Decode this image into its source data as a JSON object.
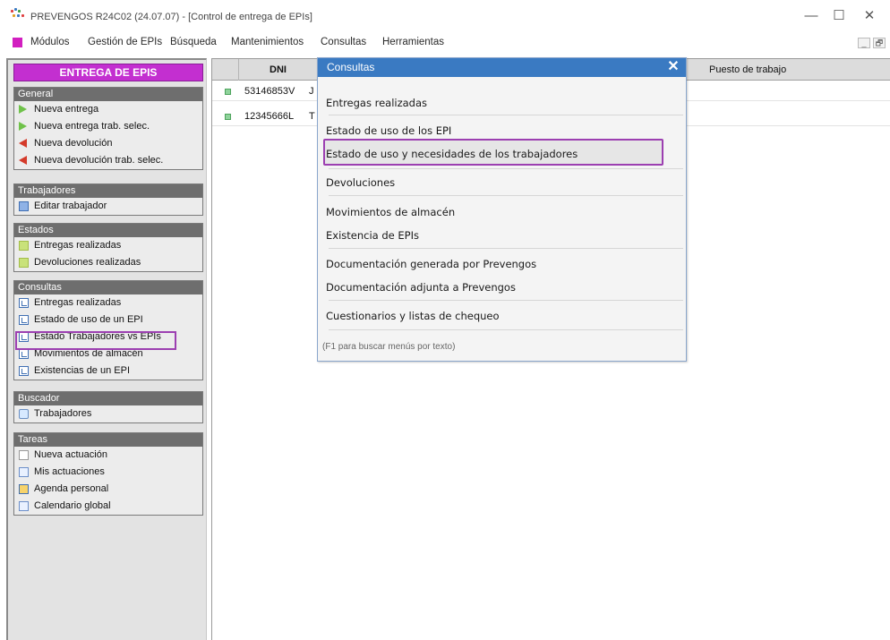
{
  "window": {
    "title": "PREVENGOS R24C02 (24.07.07) - [Control de entrega de EPIs]",
    "controls": {
      "minimize": "—",
      "maximize": "☐",
      "close": "✕"
    }
  },
  "menu": {
    "items": [
      "Módulos",
      "Gestión de EPIs",
      "Búsqueda",
      "Mantenimientos",
      "Consultas",
      "Herramientas"
    ],
    "mdi_min": "_",
    "mdi_restore": "🗗"
  },
  "left_panel": {
    "header": "ENTREGA DE EPIS",
    "sections": [
      {
        "title": "General",
        "items": [
          {
            "label": "Nueva entrega",
            "icon": "green-arrow-icon"
          },
          {
            "label": "Nueva entrega trab. selec.",
            "icon": "green-arrow-icon"
          },
          {
            "label": "Nueva devolución",
            "icon": "red-arrow-icon"
          },
          {
            "label": "Nueva devolución trab. selec.",
            "icon": "red-arrow-icon"
          }
        ]
      },
      {
        "title": "Trabajadores",
        "items": [
          {
            "label": "Editar trabajador",
            "icon": "edit-worker-icon"
          }
        ]
      },
      {
        "title": "Estados",
        "items": [
          {
            "label": "Entregas realizadas",
            "icon": "status-icon"
          },
          {
            "label": "Devoluciones realizadas",
            "icon": "status-icon"
          }
        ]
      },
      {
        "title": "Consultas",
        "items": [
          {
            "label": "Entregas realizadas",
            "icon": "query-icon"
          },
          {
            "label": "Estado de uso de un EPI",
            "icon": "query-icon"
          },
          {
            "label": "Estado Trabajadores vs EPIs",
            "icon": "query-icon",
            "highlighted": true
          },
          {
            "label": "Movimientos de almacén",
            "icon": "query-icon"
          },
          {
            "label": "Existencias de un EPI",
            "icon": "query-icon"
          }
        ]
      },
      {
        "title": "Buscador",
        "items": [
          {
            "label": "Trabajadores",
            "icon": "search-icon"
          }
        ]
      },
      {
        "title": "Tareas",
        "items": [
          {
            "label": "Nueva actuación",
            "icon": "new-action-icon"
          },
          {
            "label": "Mis actuaciones",
            "icon": "actions-grid-icon"
          },
          {
            "label": "Agenda personal",
            "icon": "agenda-icon"
          },
          {
            "label": "Calendario global",
            "icon": "calendar-icon"
          }
        ]
      }
    ]
  },
  "grid": {
    "columns": [
      "DNI",
      "Puesto de trabajo"
    ],
    "rows": [
      {
        "dni": "53146853V",
        "name_initial": "J"
      },
      {
        "dni": "12345666L",
        "name_initial": "T"
      }
    ]
  },
  "popup": {
    "title": "Consultas",
    "close": "✕",
    "items": [
      "Entregas realizadas",
      "Estado de uso de los EPI",
      "Estado de uso y necesidades de los trabajadores",
      "Devoluciones",
      "Movimientos de almacén",
      "Existencia de EPIs",
      "Documentación generada por Prevengos",
      "Documentación adjunta a Prevengos",
      "Cuestionarios y listas de chequeo"
    ],
    "highlighted_index": 2,
    "hint": "(F1 para buscar menús por texto)"
  },
  "colors": {
    "accent": "#c32fd0",
    "popup_title": "#3a7ac2",
    "highlight_border": "#9c3fb1"
  }
}
